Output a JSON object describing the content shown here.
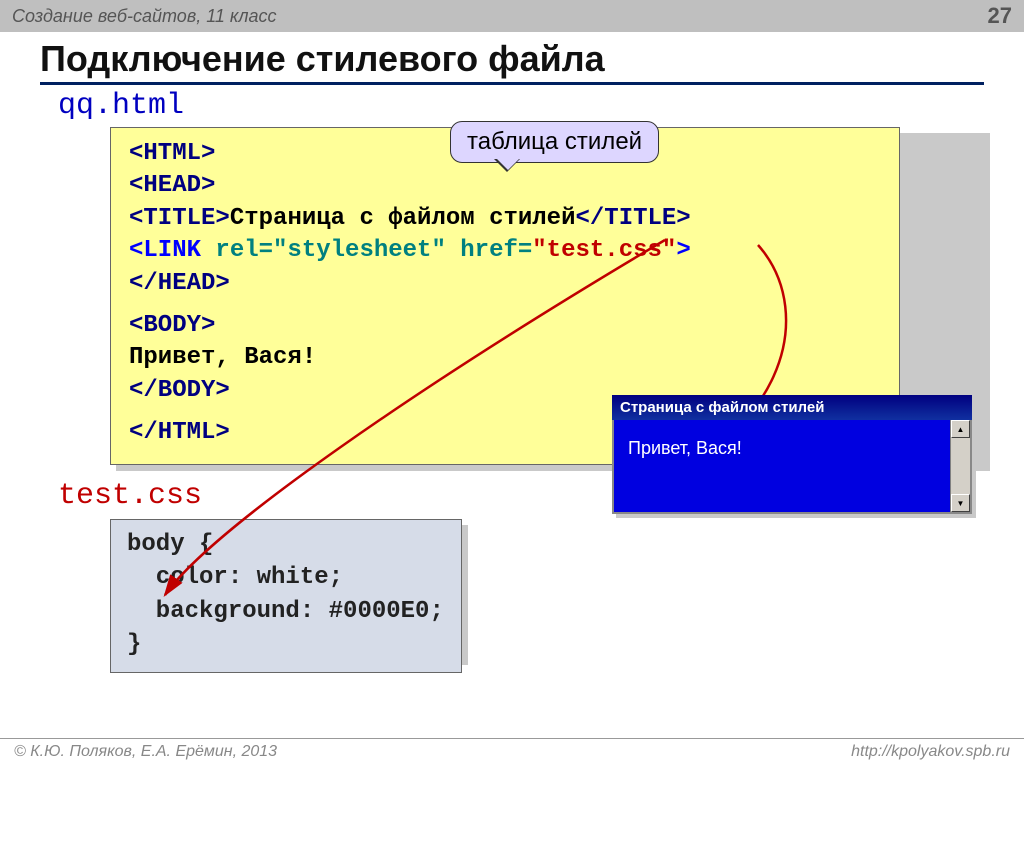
{
  "header": {
    "course": "Создание веб-сайтов, 11 класс",
    "page": "27"
  },
  "title": "Подключение стилевого файла",
  "html_file_label": "qq.html",
  "callout": "таблица стилей",
  "code_html": {
    "l1_open": "<HTML>",
    "l2_open": "<HEAD>",
    "l3_title_open": "<TITLE>",
    "l3_title_text": "Страница с файлом стилей",
    "l3_title_close": "</TITLE>",
    "l4_link_open": "<LINK ",
    "l4_rel_attr": "rel=",
    "l4_rel_val": "\"stylesheet\"",
    "l4_href_attr": " href=",
    "l4_href_val": "\"test.css\"",
    "l4_close": ">",
    "l5_head_close": "</HEAD>",
    "l6_body_open": "<BODY>",
    "l7_text": "Привет, Вася!",
    "l8_body_close": "</BODY>",
    "l9_html_close": "</HTML>"
  },
  "css_file_label": "test.css",
  "code_css": {
    "l1": "body {",
    "l2": "  color: white;",
    "l3": "  background: #0000E0;",
    "l4": "}"
  },
  "browser": {
    "title": "Страница с файлом стилей",
    "body_text": "Привет, Вася!"
  },
  "footer": {
    "copyright": "© К.Ю. Поляков, Е.А. Ерёмин, 2013",
    "url": "http://kpolyakov.spb.ru"
  }
}
